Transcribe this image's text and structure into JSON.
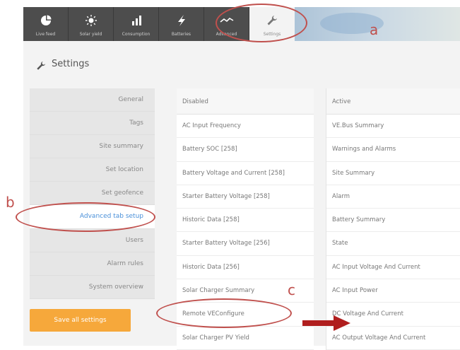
{
  "nav": {
    "tabs": [
      {
        "label": "Live feed",
        "icon": "live-feed-icon"
      },
      {
        "label": "Solar yield",
        "icon": "sun-icon"
      },
      {
        "label": "Consumption",
        "icon": "bar-chart-icon"
      },
      {
        "label": "Batteries",
        "icon": "lightning-icon"
      },
      {
        "label": "Advanced",
        "icon": "advanced-graph-icon"
      },
      {
        "label": "Settings",
        "icon": "wrench-icon",
        "active": true
      }
    ]
  },
  "header": {
    "title": "Settings"
  },
  "sidebar": {
    "items": [
      {
        "label": "General"
      },
      {
        "label": "Tags"
      },
      {
        "label": "Site summary"
      },
      {
        "label": "Set location"
      },
      {
        "label": "Set geofence"
      },
      {
        "label": "Advanced tab setup",
        "selected": true
      },
      {
        "label": "Users"
      },
      {
        "label": "Alarm rules"
      },
      {
        "label": "System overview"
      }
    ],
    "save_label": "Save all settings"
  },
  "disabled_list": {
    "header": "Disabled",
    "items": [
      "AC Input Frequency",
      "Battery SOC [258]",
      "Battery Voltage and Current [258]",
      "Starter Battery Voltage [258]",
      "Historic Data [258]",
      "Starter Battery Voltage [256]",
      "Historic Data [256]",
      "Solar Charger Summary",
      "Remote VEConfigure",
      "Solar Charger PV Yield"
    ]
  },
  "active_list": {
    "header": "Active",
    "items": [
      "VE.Bus Summary",
      "Warnings and Alarms",
      "Site Summary",
      "Alarm",
      "Battery Summary",
      "State",
      "AC Input Voltage And Current",
      "AC Input Power",
      "DC Voltage And Current",
      "AC Output Voltage And Current"
    ]
  },
  "annotations": {
    "a": "a",
    "b": "b",
    "c": "c"
  },
  "colors": {
    "accent": "#4a90d9",
    "save": "#f6a83b",
    "annotation": "#c0504d",
    "tabbar": "#4d4d4d"
  }
}
